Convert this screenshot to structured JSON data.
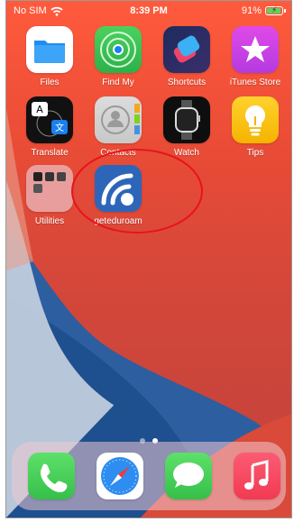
{
  "status_bar": {
    "carrier": "No SIM",
    "time": "8:39 PM",
    "battery_percent": "91%",
    "battery_level": 0.91
  },
  "apps": [
    {
      "label": "Files",
      "icon": "files-folder-icon"
    },
    {
      "label": "Find My",
      "icon": "find-my-radar-icon"
    },
    {
      "label": "Shortcuts",
      "icon": "shortcuts-icon"
    },
    {
      "label": "iTunes Store",
      "icon": "star-icon"
    },
    {
      "label": "Translate",
      "icon": "translate-icon"
    },
    {
      "label": "Contacts",
      "icon": "contact-silhouette-icon"
    },
    {
      "label": "Watch",
      "icon": "apple-watch-icon"
    },
    {
      "label": "Tips",
      "icon": "lightbulb-icon"
    },
    {
      "label": "Utilities",
      "icon": "folder-grid-icon"
    },
    {
      "label": "geteduroam",
      "icon": "wifi-signal-icon"
    }
  ],
  "dock": [
    {
      "name": "Phone",
      "icon": "phone-handset-icon"
    },
    {
      "name": "Safari",
      "icon": "compass-icon"
    },
    {
      "name": "Messages",
      "icon": "speech-bubble-icon"
    },
    {
      "name": "Music",
      "icon": "music-note-icon"
    }
  ],
  "page_indicator": {
    "pages": 2,
    "current": 2
  },
  "annotation": {
    "color": "#e8141c"
  }
}
